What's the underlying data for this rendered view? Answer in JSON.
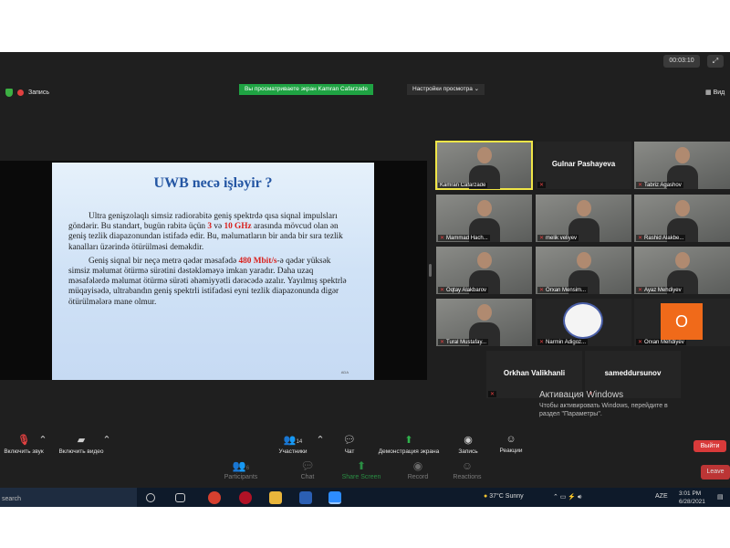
{
  "topbar": {
    "recording": "Запись",
    "viewing_banner": "Вы просматриваете экран Kamran Cafarzade",
    "view_options": "Настройки просмотра",
    "view_button": "Вид",
    "clock": "00:03:10"
  },
  "slide": {
    "title": "UWB necə işləyir ?",
    "p1": {
      "a": "Ultra genişzolaqlı simsiz radiorabitə geniş spektrdə qısa siqnal impulsları göndərir. Bu standart, bugün rabitə üçün ",
      "r1": "3",
      "b": " və ",
      "r2": "10 GHz",
      "c": " arasında mövcud olan ən geniş tezlik diapazonundan istifadə edir. Bu, məlumatların bir anda bir sıra tezlik kanalları üzərində ötürülməsi deməkdir."
    },
    "p2": {
      "a": "Geniş siqnal bir neçə metrə qədər məsafədə ",
      "r1": "480 Mbit/s",
      "b": "-ə qədər yüksək simsiz məlumat ötürmə sürətini dəstəkləməyə imkan yaradır. Daha uzaq məsafələrdə məlumat ötürmə sürəti əhəmiyyətli dərəcədə azalır. Yayılmış spektrlə müqayisədə, ultrabandın geniş spektrli istifadəsi eyni tezlik diapazonunda digər ötürülmələrə mane olmur."
    },
    "footer": "ADA"
  },
  "participants": [
    {
      "name": "Kamran Cafarzade"
    },
    {
      "name": "Gulnar Pashayeva"
    },
    {
      "name": "Tabriz Agashov"
    },
    {
      "name": "Mammad Hach..."
    },
    {
      "name": "melik veliyev"
    },
    {
      "name": "Rashid Alakbe..."
    },
    {
      "name": "Oqtay Alakbarov"
    },
    {
      "name": "Orxan Mensim..."
    },
    {
      "name": "Ayaz Mehdiyev"
    },
    {
      "name": "Tural Mustafay..."
    },
    {
      "name": "Narmin Adigoz..."
    },
    {
      "name": "Orxan Mehdiyev"
    },
    {
      "name": "Orkhan Valikhanli"
    },
    {
      "name": "sameddursunov"
    }
  ],
  "avatar_letter": "O",
  "watermark": {
    "title": "Активация Windows",
    "text1": "Чтобы активировать Windows, перейдите в",
    "text2": "раздел \"Параметры\"."
  },
  "controls": {
    "unmute": "Включить звук",
    "start_video": "Включить видео",
    "participants_count": "14",
    "participants": "Участники",
    "chat": "Чат",
    "share": "Демонстрация экрана",
    "record": "Запись",
    "reactions": "Реакции",
    "end": "Выйти"
  },
  "ghost_controls": {
    "participants_count": "6",
    "participants": "Participants",
    "chat": "Chat",
    "share": "Share Screen",
    "record": "Record",
    "reactions": "Reactions",
    "leave": "Leave"
  },
  "taskbar": {
    "search": "search",
    "temp": "37°C",
    "weather": "Sunny",
    "lang": "AZE",
    "time": "3:01 PM",
    "date": "6/28/2021"
  }
}
